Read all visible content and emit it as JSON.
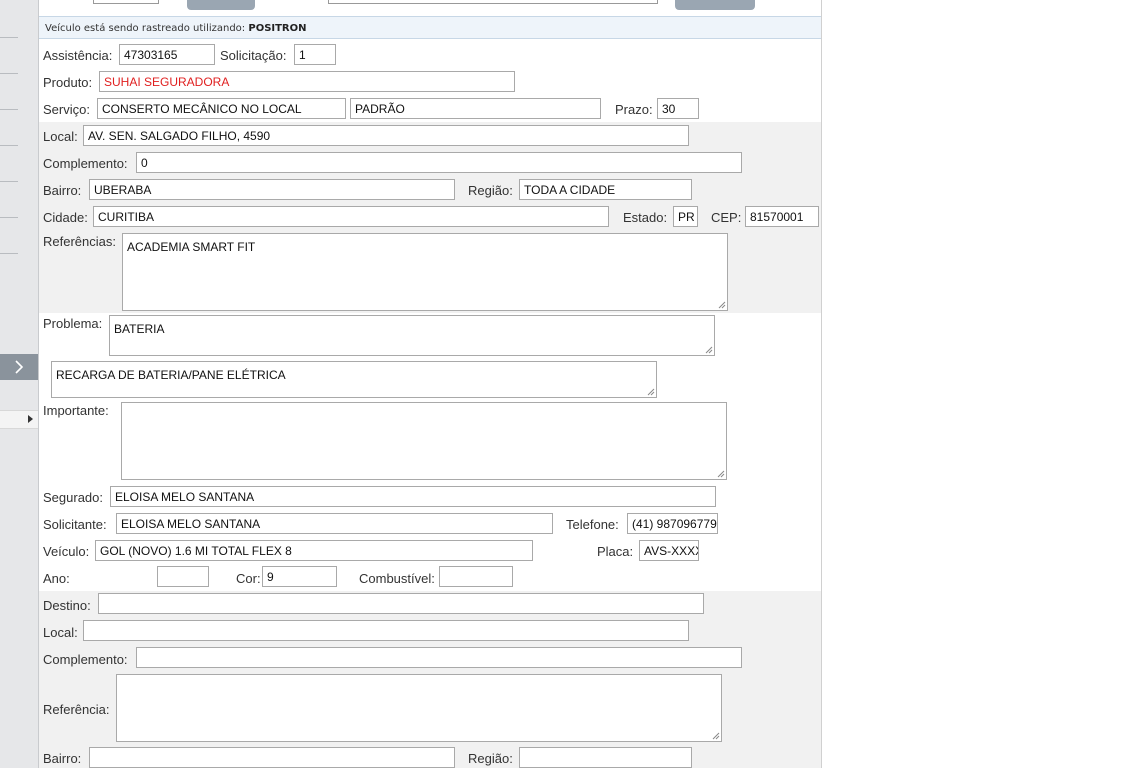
{
  "tracking": {
    "prefix": "Veículo está sendo rastreado utilizando:",
    "provider": "POSITRON"
  },
  "service": {
    "assistencia_label": "Assistência:",
    "assistencia_value": "47303165",
    "solicitacao_label": "Solicitação:",
    "solicitacao_value": "1",
    "produto_label": "Produto:",
    "produto_value": "SUHAI SEGURADORA",
    "servico_label": "Serviço:",
    "servico_value": "CONSERTO MECÂNICO NO LOCAL",
    "servico_tipo": "PADRÃO",
    "prazo_label": "Prazo:",
    "prazo_value": "30"
  },
  "origin": {
    "local_label": "Local:",
    "local_value": "AV. SEN. SALGADO FILHO, 4590",
    "complemento_label": "Complemento:",
    "complemento_value": "0",
    "bairro_label": "Bairro:",
    "bairro_value": "UBERABA",
    "regiao_label": "Região:",
    "regiao_value": "TODA A CIDADE",
    "cidade_label": "Cidade:",
    "cidade_value": "CURITIBA",
    "estado_label": "Estado:",
    "estado_value": "PR",
    "cep_label": "CEP:",
    "cep_value": "81570001",
    "referencias_label": "Referências:",
    "referencias_value": "ACADEMIA SMART FIT"
  },
  "problem": {
    "problema_label": "Problema:",
    "problema_value": "BATERIA",
    "detalhe_value": "RECARGA DE BATERIA/PANE ELÉTRICA",
    "importante_label": "Importante:",
    "importante_value": ""
  },
  "insured": {
    "segurado_label": "Segurado:",
    "segurado_value": "ELOISA MELO SANTANA",
    "solicitante_label": "Solicitante:",
    "solicitante_value": "ELOISA MELO SANTANA",
    "telefone_label": "Telefone:",
    "telefone_value": "(41) 987096779",
    "veiculo_label": "Veículo:",
    "veiculo_value": "GOL (NOVO) 1.6 MI TOTAL FLEX 8",
    "placa_label": "Placa:",
    "placa_value": "AVS-XXXX",
    "ano_label": "Ano:",
    "ano_value": "",
    "cor_label": "Cor:",
    "cor_value": "9",
    "combustivel_label": "Combustível:",
    "combustivel_value": ""
  },
  "destination": {
    "destino_label": "Destino:",
    "destino_value": "",
    "local_label": "Local:",
    "local_value": "",
    "complemento_label": "Complemento:",
    "complemento_value": "",
    "referencia_label": "Referência:",
    "referencia_value": "",
    "bairro_label": "Bairro:",
    "bairro_value": "",
    "regiao_label": "Região:",
    "regiao_value": ""
  },
  "colors": {
    "produto_text": "#e02020",
    "band": "#f1f1f1",
    "sidebar": "#e6e7e9"
  },
  "icons": {
    "sidebar_toggle": "chevron-right-icon",
    "sidebar_item": "caret-right-icon",
    "resize": "resize-grip-icon"
  }
}
